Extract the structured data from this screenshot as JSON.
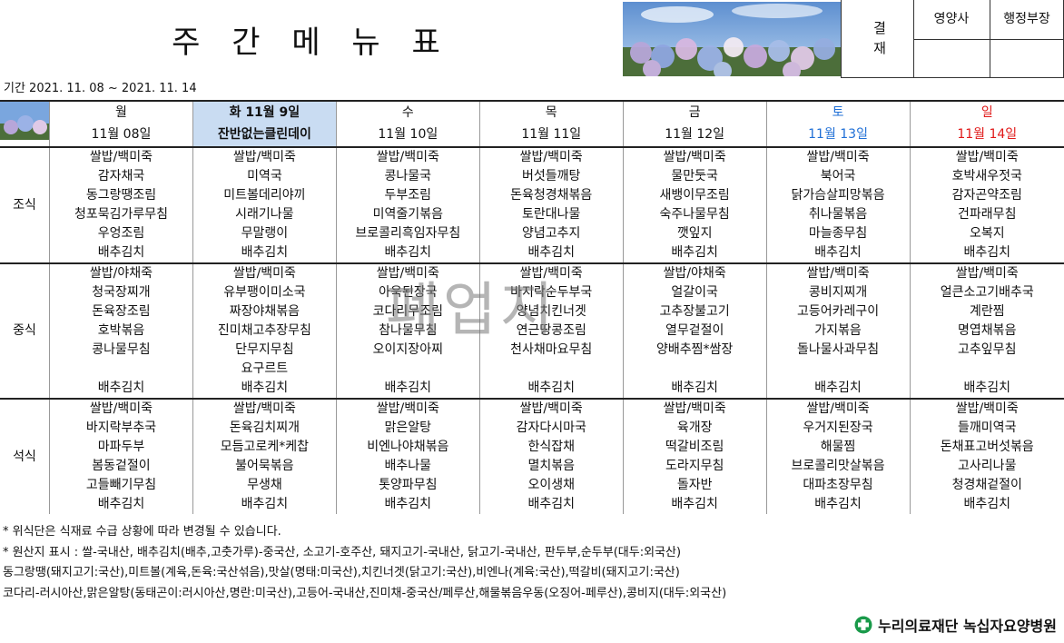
{
  "header": {
    "title": "주 간 메 뉴 표",
    "approval_label": "결\n재",
    "approvers": [
      "영양사",
      "행정부장"
    ]
  },
  "period": "기간 2021. 11. 08 ~ 2021. 11. 14",
  "days": [
    {
      "day": "월",
      "date": "11월 08일"
    },
    {
      "day": "화  11월 9일",
      "date": "잔반없는클린데이"
    },
    {
      "day": "수",
      "date": "11월 10일"
    },
    {
      "day": "목",
      "date": "11월 11일"
    },
    {
      "day": "금",
      "date": "11월 12일"
    },
    {
      "day": "토",
      "date": "11월 13일"
    },
    {
      "day": "일",
      "date": "11월 14일"
    }
  ],
  "meals": [
    {
      "label": "조식",
      "rows": [
        [
          "쌀밥/백미죽",
          "쌀밥/백미죽",
          "쌀밥/백미죽",
          "쌀밥/백미죽",
          "쌀밥/백미죽",
          "쌀밥/백미죽",
          "쌀밥/백미죽"
        ],
        [
          "감자채국",
          "미역국",
          "콩나물국",
          "버섯들깨탕",
          "물만둣국",
          "북어국",
          "호박새우젓국"
        ],
        [
          "동그랑땡조림",
          "미트볼데리야끼",
          "두부조림",
          "돈육청경채볶음",
          "새뱅이무조림",
          "닭가슴살피망볶음",
          "감자곤약조림"
        ],
        [
          "청포묵김가루무침",
          "시래기나물",
          "미역줄기볶음",
          "토란대나물",
          "숙주나물무침",
          "취나물볶음",
          "건파래무침"
        ],
        [
          "우엉조림",
          "무말랭이",
          "브로콜리흑임자무침",
          "양념고추지",
          "깻잎지",
          "마늘종무침",
          "오복지"
        ],
        [
          "배추김치",
          "배추김치",
          "배추김치",
          "배추김치",
          "배추김치",
          "배추김치",
          "배추김치"
        ]
      ]
    },
    {
      "label": "중식",
      "rows": [
        [
          "쌀밥/야채죽",
          "쌀밥/백미죽",
          "쌀밥/백미죽",
          "쌀밥/백미죽",
          "쌀밥/야채죽",
          "쌀밥/백미죽",
          "쌀밥/백미죽"
        ],
        [
          "청국장찌개",
          "유부팽이미소국",
          "아욱된장국",
          "바지락순두부국",
          "얼갈이국",
          "콩비지찌개",
          "얼큰소고기배추국"
        ],
        [
          "돈육장조림",
          "짜장야채볶음",
          "코다리무조림",
          "양념치킨너겟",
          "고추장불고기",
          "고등어카레구이",
          "계란찜"
        ],
        [
          "호박볶음",
          "진미채고추장무침",
          "참나물무침",
          "연근땅콩조림",
          "열무겉절이",
          "가지볶음",
          "명엽채볶음"
        ],
        [
          "콩나물무침",
          "단무지무침",
          "오이지장아찌",
          "천사채마요무침",
          "양배추찜*쌈장",
          "돌나물사과무침",
          "고추잎무침"
        ],
        [
          "",
          "요구르트",
          "",
          "",
          "",
          "",
          ""
        ],
        [
          "배추김치",
          "배추김치",
          "배추김치",
          "배추김치",
          "배추김치",
          "배추김치",
          "배추김치"
        ]
      ]
    },
    {
      "label": "석식",
      "rows": [
        [
          "쌀밥/백미죽",
          "쌀밥/백미죽",
          "쌀밥/백미죽",
          "쌀밥/백미죽",
          "쌀밥/백미죽",
          "쌀밥/백미죽",
          "쌀밥/백미죽"
        ],
        [
          "바지락부추국",
          "돈육김치찌개",
          "맑은알탕",
          "감자다시마국",
          "육개장",
          "우거지된장국",
          "들깨미역국"
        ],
        [
          "마파두부",
          "모듬고로케*케찹",
          "비엔나야채볶음",
          "한식잡채",
          "떡갈비조림",
          "해물찜",
          "돈채표고버섯볶음"
        ],
        [
          "봄동겉절이",
          "불어묵볶음",
          "배추나물",
          "멸치볶음",
          "도라지무침",
          "브로콜리맛살볶음",
          "고사리나물"
        ],
        [
          "고들빼기무침",
          "무생채",
          "톳양파무침",
          "오이생채",
          "돌자반",
          "대파초장무침",
          "청경채겉절이"
        ],
        [
          "배추김치",
          "배추김치",
          "배추김치",
          "배추김치",
          "배추김치",
          "배추김치",
          "배추김치"
        ]
      ]
    }
  ],
  "notes": [
    "* 위식단은 식재료 수급 상황에 따라 변경될 수 있습니다.",
    "* 원산지 표시 : 쌀-국내산, 배추김치(배추,고춧가루)-중국산, 소고기-호주산, 돼지고기-국내산, 닭고기-국내산, 판두부,순두부(대두:외국산)",
    "동그랑땡(돼지고기:국산),미트볼(계육,돈육:국산섞음),맛살(명태:미국산),치킨너겟(닭고기:국산),비엔나(계육:국산),떡갈비(돼지고기:국산)",
    "코다리-러시아산,맑은알탕(동태곤이:러시아산,명란:미국산),고등어-국내산,진미채-중국산/페루산,해물볶음우동(오징어-페루산),콩비지(대두:외국산)"
  ],
  "footer": {
    "org": "누리의료재단 녹십자요양병원"
  },
  "watermark": "폐업지",
  "colors": {
    "saturday": "#1f6fd6",
    "sunday": "#e01818",
    "tuesday_bg": "#c9dcf2",
    "logo_green": "#1a9a4a"
  }
}
